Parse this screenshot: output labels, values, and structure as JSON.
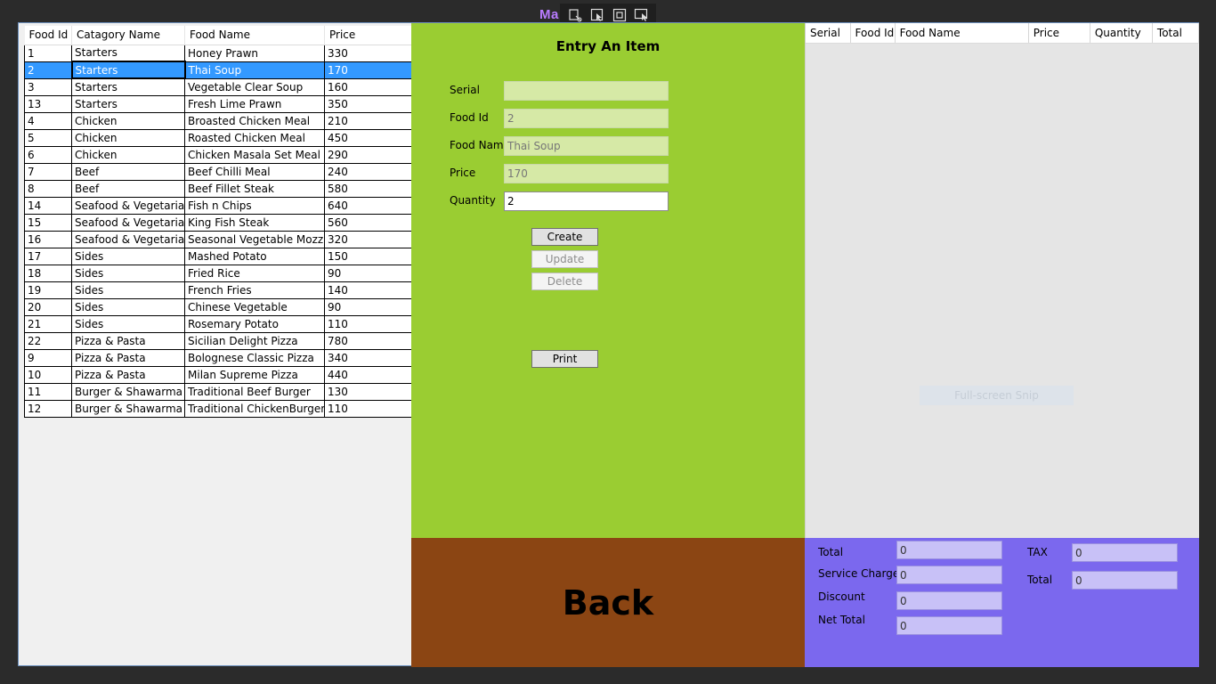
{
  "app": {
    "title": "Ma  ing"
  },
  "snip_toolbar": {
    "icons": [
      "free-form-snip-icon",
      "window-snip-icon",
      "rectangular-snip-icon",
      "fullscreen-snip-icon"
    ]
  },
  "menu_grid": {
    "columns": [
      "Food Id",
      "Catagory Name",
      "Food Name",
      "Price"
    ],
    "rows": [
      [
        "1",
        "Starters",
        "Honey Prawn",
        "330"
      ],
      [
        "2",
        "Starters",
        "Thai Soup",
        "170"
      ],
      [
        "3",
        "Starters",
        "Vegetable Clear Soup",
        "160"
      ],
      [
        "13",
        "Starters",
        "Fresh Lime Prawn",
        "350"
      ],
      [
        "4",
        "Chicken",
        "Broasted Chicken Meal",
        "210"
      ],
      [
        "5",
        "Chicken",
        "Roasted Chicken Meal",
        "450"
      ],
      [
        "6",
        "Chicken",
        "Chicken Masala Set Meal",
        "290"
      ],
      [
        "7",
        "Beef",
        "Beef Chilli Meal",
        "240"
      ],
      [
        "8",
        "Beef",
        "Beef Fillet Steak",
        "580"
      ],
      [
        "14",
        "Seafood & Vegetarian",
        "Fish n Chips",
        "640"
      ],
      [
        "15",
        "Seafood & Vegetarian",
        "King Fish Steak",
        "560"
      ],
      [
        "16",
        "Seafood & Vegetarian",
        "Seasonal Vegetable Mozzare",
        "320"
      ],
      [
        "17",
        "Sides",
        "Mashed Potato",
        "150"
      ],
      [
        "18",
        "Sides",
        "Fried Rice",
        "90"
      ],
      [
        "19",
        "Sides",
        "French Fries",
        "140"
      ],
      [
        "20",
        "Sides",
        "Chinese Vegetable",
        "90"
      ],
      [
        "21",
        "Sides",
        "Rosemary Potato",
        "110"
      ],
      [
        "22",
        "Pizza & Pasta",
        "Sicilian Delight Pizza",
        "780"
      ],
      [
        "9",
        "Pizza & Pasta",
        "Bolognese Classic Pizza",
        "340"
      ],
      [
        "10",
        "Pizza & Pasta",
        "Milan Supreme Pizza",
        "440"
      ],
      [
        "11",
        "Burger & Shawarma",
        "Traditional Beef Burger",
        "130"
      ],
      [
        "12",
        "Burger & Shawarma",
        "Traditional ChickenBurger",
        "110"
      ]
    ],
    "selected_row": 1
  },
  "entry": {
    "title": "Entry An Item",
    "serial_label": "Serial",
    "serial_value": "",
    "food_id_label": "Food Id",
    "food_id_value": "2",
    "food_name_label": "Food Name",
    "food_name_value": "Thai Soup",
    "price_label": "Price",
    "price_value": "170",
    "quantity_label": "Quantity",
    "quantity_value": "2",
    "create_label": "Create",
    "update_label": "Update",
    "delete_label": "Delete",
    "print_label": "Print"
  },
  "back": {
    "label": "Back"
  },
  "order_grid": {
    "columns": [
      "Serial",
      "Food Id",
      "Food Name",
      "Price",
      "Quantity",
      "Total"
    ],
    "snip_hint": "Full-screen Snip"
  },
  "totals": {
    "total_label": "Total",
    "total_value": "0",
    "service_charge_label": "Service Charge",
    "service_charge_value": "0",
    "discount_label": "Discount",
    "discount_value": "0",
    "net_total_label": "Net Total",
    "net_total_value": "0",
    "tax_label": "TAX",
    "tax_value": "0",
    "grand_total_label": "Total",
    "grand_total_value": "0"
  },
  "colors": {
    "entry_panel": "#9acd32",
    "back_panel": "#8b4513",
    "totals_panel": "#7b68ee",
    "selection": "#3399ff",
    "title": "#b97cff"
  }
}
